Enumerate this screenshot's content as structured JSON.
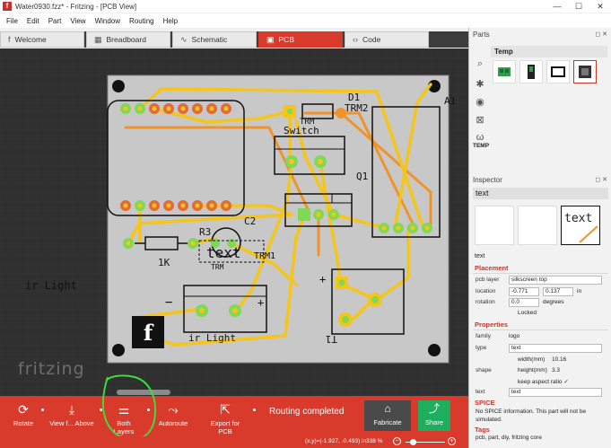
{
  "window": {
    "title": "Water0930.fzz* - Fritzing - [PCB View]",
    "icon_letter": "f",
    "minimize": "—",
    "maximize": "☐",
    "close": "✕"
  },
  "menu": [
    "File",
    "Edit",
    "Part",
    "View",
    "Window",
    "Routing",
    "Help"
  ],
  "tabs": [
    {
      "label": "Welcome",
      "icon": "f",
      "active": false
    },
    {
      "label": "Breadboard",
      "icon": "▦",
      "active": false
    },
    {
      "label": "Schematic",
      "icon": "∿",
      "active": false
    },
    {
      "label": "PCB",
      "icon": "▣",
      "active": true
    },
    {
      "label": "Code",
      "icon": "‹›",
      "active": false
    }
  ],
  "pcb": {
    "labels": {
      "d1": "D1",
      "trm2": "TRM2",
      "a1": "A1",
      "trm_top": "TRM",
      "switch": "Switch",
      "q1": "Q1",
      "r3": "R3",
      "c2": "C2",
      "text_logo": "text",
      "trm1": "TRM1",
      "trm_mid": "TRM",
      "r_value": "1K",
      "minus": "−",
      "plus": "+",
      "plus2": "+",
      "ir_light": "ir Light",
      "t1": "T1"
    },
    "outer_label": "ir Light",
    "watermark": "fritzing"
  },
  "toolbar": {
    "rotate": "Rotate",
    "view_from_above": "View f... Above",
    "both_layers": "Both Layers",
    "autoroute": "Autoroute",
    "export_pcb": "Export for PCB",
    "routing_status": "Routing completed",
    "fabricate": "Fabricate",
    "share": "Share"
  },
  "statusbar": {
    "coords": "(x,y)=(-1.927, -0.493) in",
    "zoom": "338 %",
    "zoom_level": 0.12
  },
  "parts": {
    "header": "Parts",
    "bin_name": "Temp",
    "strip_label": "TEMP"
  },
  "inspector": {
    "header": "Inspector",
    "title": "text",
    "preview_text": "text",
    "name": "text",
    "placement_title": "Placement",
    "pcb_layer_label": "pcb layer",
    "pcb_layer_value": "silkscreen top",
    "location_label": "location",
    "location_x": "-0.771",
    "location_y": "0.137",
    "location_unit": "in",
    "rotation_label": "rotation",
    "rotation_value": "0.0",
    "rotation_unit": "degrees",
    "locked_label": "Locked",
    "properties_title": "Properties",
    "family_label": "family",
    "family_value": "logo",
    "type_label": "type",
    "type_value": "text",
    "shape_label": "shape",
    "width_label": "width(mm)",
    "width_value": "10.16",
    "height_label": "height(mm)",
    "height_value": "3.3",
    "aspect_label": "keep aspect ratio",
    "text_label": "text",
    "text_value": "text",
    "spice_title": "SPICE",
    "spice_text": "No SPICE information. This part will not be simulated.",
    "tags_title": "Tags",
    "tags_text": "pcb, part, diy, fritzing core"
  },
  "colors": {
    "accent": "#d83a2c",
    "share_green": "#1fae5d",
    "trace_yellow": "#f5c518",
    "trace_orange": "#f0932b",
    "board_gray": "#c8c8c8",
    "pad_green": "#7ed957",
    "highlight_green": "#3ddc3d"
  }
}
